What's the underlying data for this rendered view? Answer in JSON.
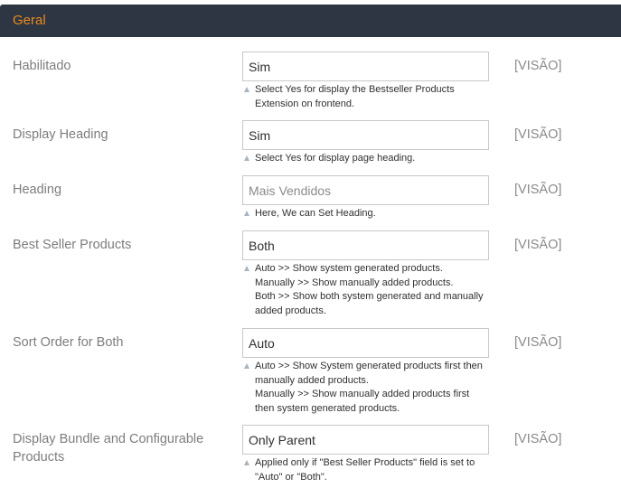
{
  "section": {
    "title": "Geral"
  },
  "rows": [
    {
      "label": "Habilitado",
      "value": "Sim",
      "scope": "[VISÃO]",
      "note": [
        "Select Yes for display the Bestseller Products",
        "Extension on frontend."
      ]
    },
    {
      "label": "Display Heading",
      "value": "Sim",
      "scope": "[VISÃO]",
      "note": [
        "Select Yes for display page heading."
      ]
    },
    {
      "label": "Heading",
      "value": "Mais Vendidos",
      "scope": "[VISÃO]",
      "note": [
        "Here, We can Set Heading."
      ]
    },
    {
      "label": "Best Seller Products",
      "value": "Both",
      "scope": "[VISÃO]",
      "note": [
        "Auto >> Show system generated products.",
        "Manually >> Show manually added products.",
        "Both >> Show both system generated and manually",
        "added products."
      ]
    },
    {
      "label": "Sort Order for Both",
      "value": "Auto",
      "scope": "[VISÃO]",
      "note": [
        "Auto >> Show System generated products first then",
        "manually added products.",
        "Manually >> Show manually added products first",
        "then system generated products."
      ]
    },
    {
      "label_lines": [
        "Display Bundle and Configurable",
        "Products"
      ],
      "value": "Only Parent",
      "scope": "[VISÃO]",
      "note": [
        "Applied only if \"Best Seller Products\" field is set to",
        "\"Auto\" or \"Both\"."
      ]
    }
  ],
  "icons": {
    "note_marker": "triangle-up-icon"
  },
  "colors": {
    "header_bg": "#2e3543",
    "header_text": "#eb8b1c",
    "label": "#7d7d7d",
    "border": "#c8c8c8"
  }
}
